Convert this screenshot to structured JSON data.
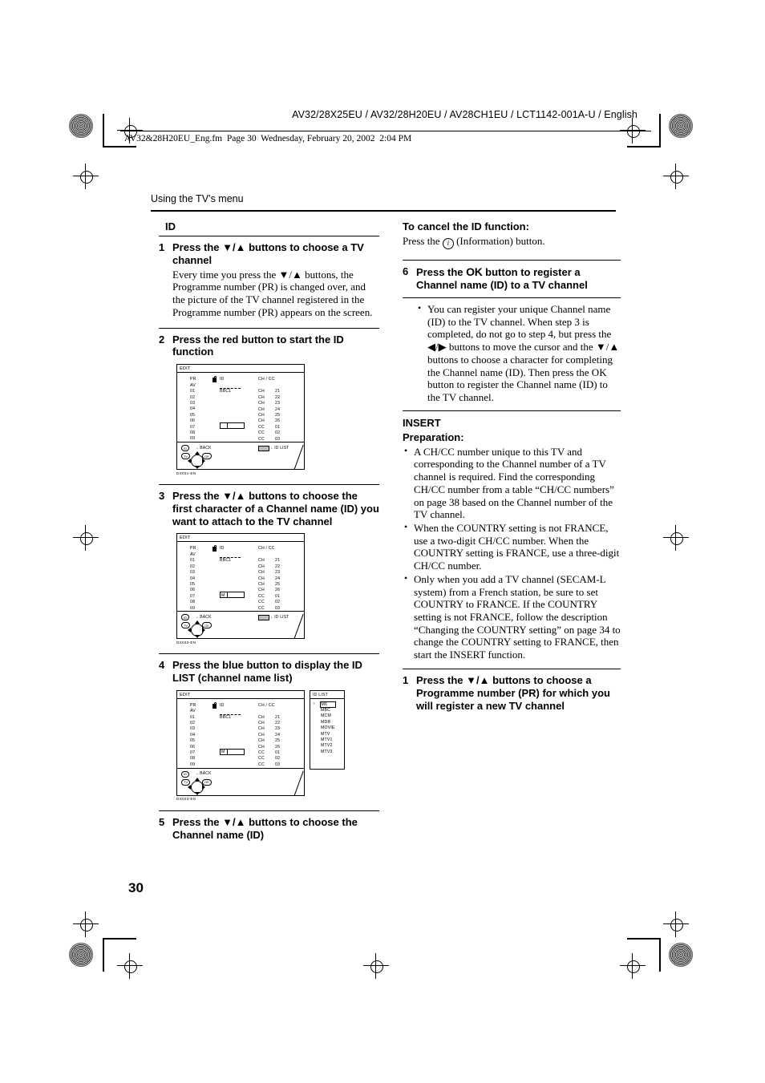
{
  "header": {
    "model_line": "AV32/28X25EU / AV32/28H20EU / AV28CH1EU / LCT1142-001A-U / English",
    "fm_line": "AV32&28H20EU_Eng.fm  Page 30  Wednesday, February 20, 2002  2:04 PM"
  },
  "running_head": "Using the TV’s menu",
  "page_number": "30",
  "left_column": {
    "section_title": "ID",
    "step1": {
      "num": "1",
      "head": "Press the ▼/▲ buttons to choose a TV channel",
      "body": "Every time you press the ▼/▲ buttons, the Programme number (PR) is changed over, and the picture of the TV channel registered in the Programme number (PR) appears on the screen."
    },
    "step2": {
      "num": "2",
      "head": "Press the red button to start the ID function"
    },
    "step3": {
      "num": "3",
      "head": "Press the ▼/▲ buttons to choose the first character of a Channel name (ID) you want to attach to the TV channel"
    },
    "step4": {
      "num": "4",
      "head": "Press the blue button to display the ID LIST (channel name list)"
    },
    "step5": {
      "num": "5",
      "head": "Press the ▼/▲ buttons to choose the Channel name (ID)"
    }
  },
  "osd": {
    "title": "EDIT",
    "col_pr": "PR",
    "col_id": "ID",
    "col_chcc": "CH / CC",
    "lock_icon": "lock-icon",
    "pr_rows": [
      "AV",
      "01",
      "02",
      "03",
      "04",
      "05",
      "06",
      "07",
      "08",
      "09"
    ],
    "ch_rows": [
      "",
      "CH",
      "CH",
      "CH",
      "CH",
      "CH",
      "CH",
      "CC",
      "CC",
      "CC"
    ],
    "cc_rows": [
      "",
      "21",
      "22",
      "23",
      "24",
      "25",
      "26",
      "01",
      "02",
      "03"
    ],
    "id_value": "BBC1",
    "cursor_char": "M",
    "foot_back_btn": "ID",
    "foot_back_label": "BACK",
    "foot_idlist_label": "ID LIST",
    "foot_tv_btn": "TV",
    "foot_ok_btn": "OK",
    "fig_code_1": "DX031-EN",
    "fig_code_2": "DX032-EN",
    "fig_code_3": "DX033-EN"
  },
  "idlist": {
    "title": "ID LIST",
    "cursor": "○",
    "selected": "M6",
    "items": [
      "MBC",
      "MCM",
      "MDR",
      "MOVIE",
      "MTV",
      "MTV1",
      "MTV2",
      "MTV3"
    ]
  },
  "right_column": {
    "cancel_title": "To cancel the ID function:",
    "cancel_body_pre": "Press the ",
    "cancel_body_post": " (Information) button.",
    "step6": {
      "num": "6",
      "head_pre": "Press the ",
      "head_ok": "OK",
      "head_post": " button to register a Channel name (ID) to a TV channel",
      "bullet": "You can register your unique Channel name (ID) to the TV channel. When step 3 is completed, do not go to step 4, but press the ◀/▶ buttons to move the cursor and the ▼/▲ buttons to choose a character for completing the Channel name (ID). Then press the OK button to register the Channel name (ID) to the TV channel."
    },
    "insert_title": "INSERT",
    "preparation_title": "Preparation:",
    "prep_bullets": [
      "A CH/CC number unique to this TV and corresponding to the Channel number of a TV channel is required. Find the corresponding CH/CC number from a table “CH/CC numbers” on page 38 based on the Channel number of the TV channel.",
      "When the COUNTRY setting is not FRANCE, use a two-digit CH/CC number. When the COUNTRY setting is FRANCE, use a three-digit CH/CC number.",
      "Only when you add a TV channel (SECAM-L system) from a French station, be sure to set COUNTRY to FRANCE. If the COUNTRY setting is not FRANCE, follow the description “Changing the COUNTRY setting” on page 34 to change the COUNTRY setting to FRANCE, then start the INSERT function."
    ],
    "insert_step1": {
      "num": "1",
      "head": "Press the ▼/▲ buttons to choose a Programme number (PR) for which you will register a new TV channel"
    }
  }
}
